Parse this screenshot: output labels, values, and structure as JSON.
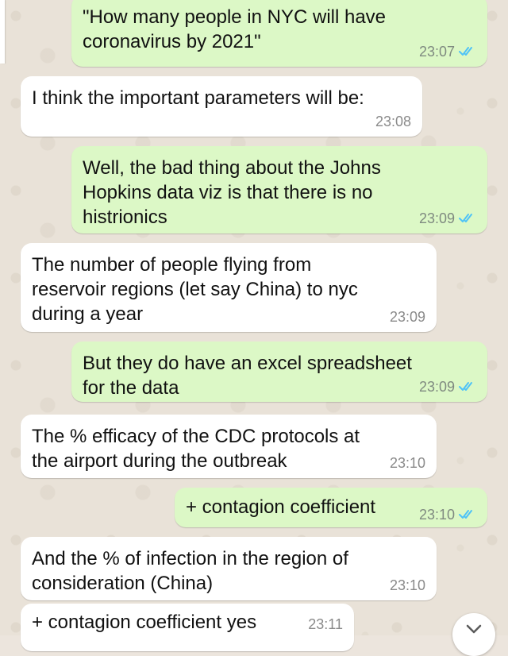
{
  "messages": [
    {
      "dir": "out",
      "text": "\"How many people in NYC will have\ncoronavirus by 2021\"",
      "time": "23:07",
      "read": true
    },
    {
      "dir": "in",
      "text": "I think the important parameters will be:",
      "time": "23:08"
    },
    {
      "dir": "out",
      "text": "Well, the bad thing about the Johns\nHopkins data viz is that there is no\nhistrionics",
      "time": "23:09",
      "read": true
    },
    {
      "dir": "in",
      "text": "The number of people flying from\nreservoir regions (let say China) to nyc\nduring a year",
      "time": "23:09"
    },
    {
      "dir": "out",
      "text": "But they do have an excel spreadsheet\nfor the data",
      "time": "23:09",
      "read": true
    },
    {
      "dir": "in",
      "text": "The % efficacy of the CDC protocols at\nthe airport during the outbreak",
      "time": "23:10"
    },
    {
      "dir": "out",
      "text": "+ contagion coefficient",
      "time": "23:10",
      "read": true
    },
    {
      "dir": "in",
      "text": "And the % of infection in the region of\nconsideration (China)",
      "time": "23:10"
    },
    {
      "dir": "in",
      "text": "+ contagion coefficient yes",
      "time": "23:11"
    }
  ],
  "colors": {
    "outgoing_bubble": "#dcf8c6",
    "incoming_bubble": "#ffffff",
    "read_ticks": "#4fc3f7",
    "wallpaper": "#ece5dd"
  },
  "icons": {
    "read_receipt": "double-check-icon",
    "scroll_down": "chevron-down-icon"
  }
}
